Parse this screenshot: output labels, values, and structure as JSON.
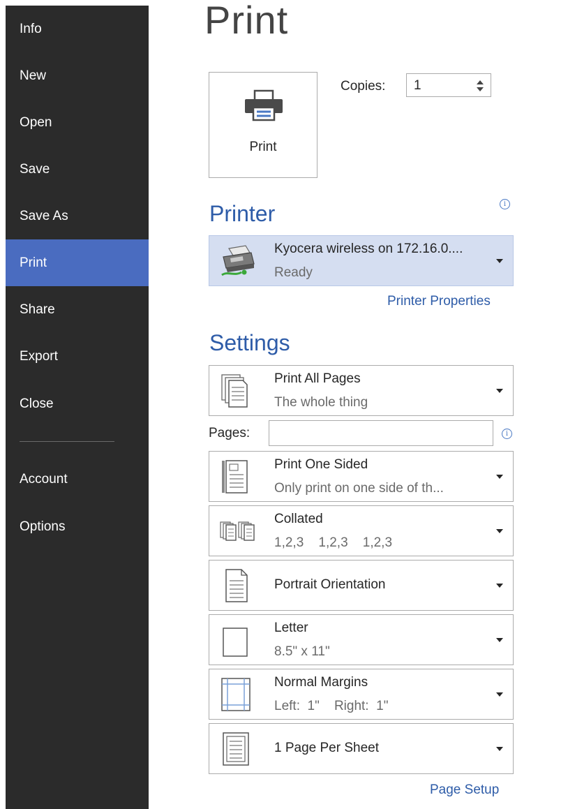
{
  "sidebar": {
    "items": [
      {
        "label": "Info"
      },
      {
        "label": "New"
      },
      {
        "label": "Open"
      },
      {
        "label": "Save"
      },
      {
        "label": "Save As"
      },
      {
        "label": "Print",
        "active": true
      },
      {
        "label": "Share"
      },
      {
        "label": "Export"
      },
      {
        "label": "Close"
      }
    ],
    "bottom_items": [
      {
        "label": "Account"
      },
      {
        "label": "Options"
      }
    ],
    "bg_color": "#2b2b2b",
    "active_color": "#4a6cc0"
  },
  "main": {
    "title": "Print",
    "print_button_label": "Print",
    "copies": {
      "label": "Copies:",
      "value": "1"
    },
    "printer": {
      "heading": "Printer",
      "name": "Kyocera wireless on 172.16.0....",
      "status": "Ready",
      "properties_link": "Printer Properties"
    },
    "settings": {
      "heading": "Settings",
      "pages_label": "Pages:",
      "pages_value": "",
      "items": [
        {
          "main": "Print All Pages",
          "sub": "The whole thing",
          "icon": "pages-stack-icon"
        },
        {
          "main": "Print One Sided",
          "sub": "Only print on one side of th...",
          "icon": "one-sided-icon"
        },
        {
          "main": "Collated",
          "sub": "1,2,3    1,2,3    1,2,3",
          "icon": "collated-icon"
        },
        {
          "main": "Portrait Orientation",
          "sub": "",
          "icon": "portrait-icon"
        },
        {
          "main": "Letter",
          "sub": "8.5\" x 11\"",
          "icon": "paper-size-icon"
        },
        {
          "main": "Normal Margins",
          "sub": "Left:  1\"    Right:  1\"",
          "icon": "margins-icon"
        },
        {
          "main": "1 Page Per Sheet",
          "sub": "",
          "icon": "pages-per-sheet-icon"
        }
      ],
      "page_setup_link": "Page Setup"
    },
    "accent_color": "#2e5ca8"
  }
}
